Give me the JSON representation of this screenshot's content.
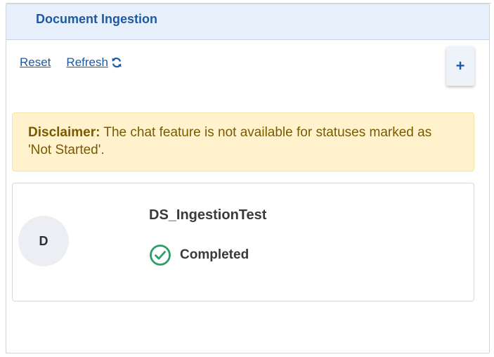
{
  "panel": {
    "title": "Document Ingestion"
  },
  "toolbar": {
    "reset_label": "Reset",
    "refresh_label": "Refresh",
    "add_label": "+"
  },
  "disclaimer": {
    "strong": "Disclaimer:",
    "text": " The chat feature is not available for statuses marked as 'Not Started'."
  },
  "document": {
    "avatar_letter": "D",
    "name": "DS_IngestionTest",
    "status": "Completed",
    "status_color": "#2e9e68"
  },
  "colors": {
    "accent": "#1f5aa0",
    "header_bg": "#e6effa",
    "warning_bg": "#fff2cc",
    "warning_text": "#7a5a00"
  }
}
